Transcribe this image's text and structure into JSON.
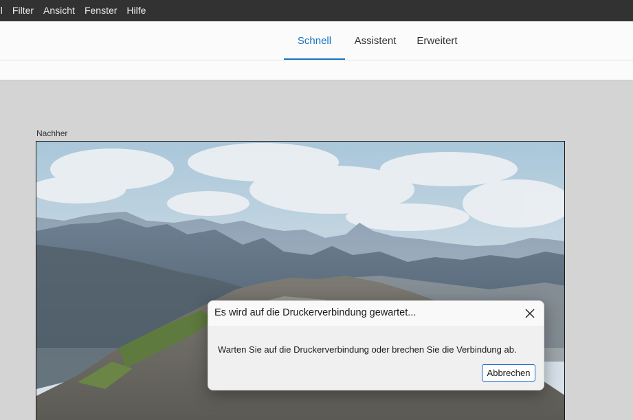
{
  "menubar": {
    "items": [
      {
        "label": "hl"
      },
      {
        "label": "Filter"
      },
      {
        "label": "Ansicht"
      },
      {
        "label": "Fenster"
      },
      {
        "label": "Hilfe"
      }
    ]
  },
  "modes": {
    "tabs": [
      {
        "label": "Schnell",
        "active": true
      },
      {
        "label": "Assistent",
        "active": false
      },
      {
        "label": "Erweitert",
        "active": false
      }
    ]
  },
  "canvas": {
    "view_label": "Nachher",
    "image": "mountain-landscape-photo"
  },
  "dialog": {
    "title": "Es wird auf die Druckerverbindung gewartet...",
    "message": "Warten Sie auf die Druckerverbindung oder brechen Sie die Verbindung ab.",
    "cancel_label": "Abbrechen",
    "close_icon": "close-icon"
  },
  "colors": {
    "accent": "#1473c2",
    "menubar_bg": "#323232",
    "workspace_bg": "#d4d4d4",
    "dialog_button_border": "#0a64c8"
  }
}
